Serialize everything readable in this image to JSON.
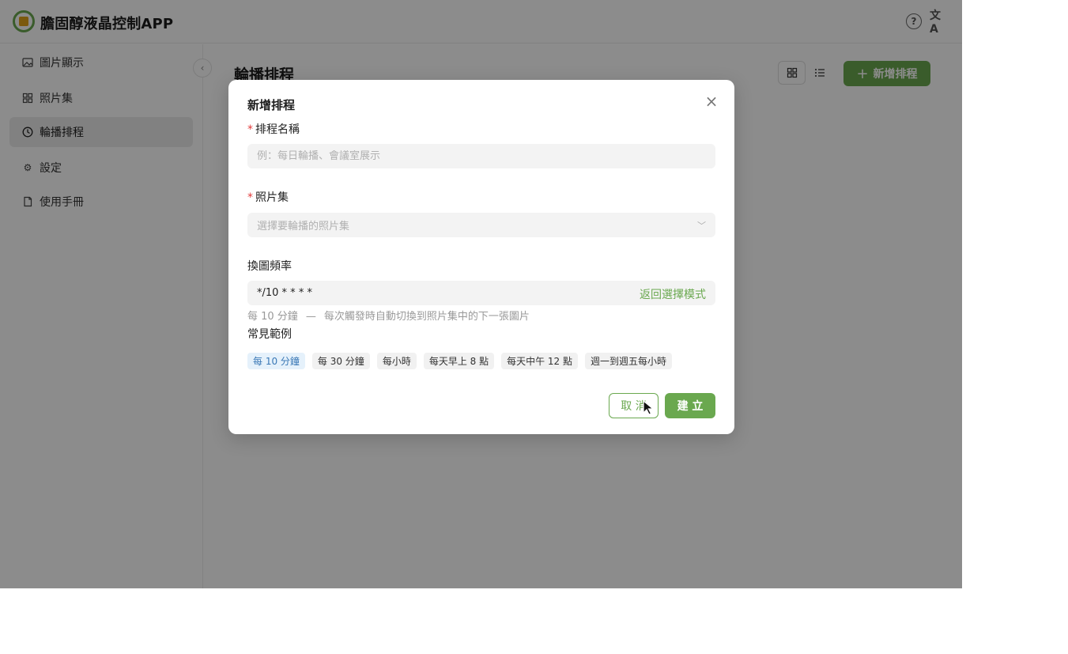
{
  "app": {
    "title": "膽固醇液晶控制APP",
    "help_icon": "question-circle-icon",
    "translate_icon": "translate-icon"
  },
  "sidebar": {
    "items": [
      {
        "label": "圖片顯示",
        "icon": "image-icon",
        "active": false
      },
      {
        "label": "照片集",
        "icon": "grid-icon",
        "active": false
      },
      {
        "label": "輪播排程",
        "icon": "clock-icon",
        "active": true
      },
      {
        "label": "設定",
        "icon": "gear-icon",
        "active": false
      },
      {
        "label": "使用手冊",
        "icon": "book-icon",
        "active": false
      }
    ]
  },
  "main": {
    "title": "輪播排程",
    "add_button_label": "新增排程"
  },
  "modal": {
    "title": "新增排程",
    "name_field": {
      "label": "排程名稱",
      "placeholder": "例：每日輪播、會議室展示",
      "value": ""
    },
    "album_field": {
      "label": "照片集",
      "placeholder": "選擇要輪播的照片集"
    },
    "frequency_field": {
      "label": "換圖頻率",
      "value": "*/10 * * * *",
      "back_link": "返回選擇模式"
    },
    "hint": {
      "interval": "每 10 分鐘",
      "separator": "—",
      "description": "每次觸發時自動切換到照片集中的下一張圖片"
    },
    "examples": {
      "label": "常見範例",
      "chips": [
        {
          "label": "每 10 分鐘",
          "selected": true
        },
        {
          "label": "每 30 分鐘",
          "selected": false
        },
        {
          "label": "每小時",
          "selected": false
        },
        {
          "label": "每天早上 8 點",
          "selected": false
        },
        {
          "label": "每天中午 12 點",
          "selected": false
        },
        {
          "label": "週一到週五每小時",
          "selected": false
        }
      ]
    },
    "cancel_label": "取 消",
    "create_label": "建 立"
  },
  "colors": {
    "accent": "#6aa84f",
    "required": "#e23b3b",
    "chip_selected_bg": "#e5f1fb",
    "chip_selected_text": "#3a78b6"
  }
}
